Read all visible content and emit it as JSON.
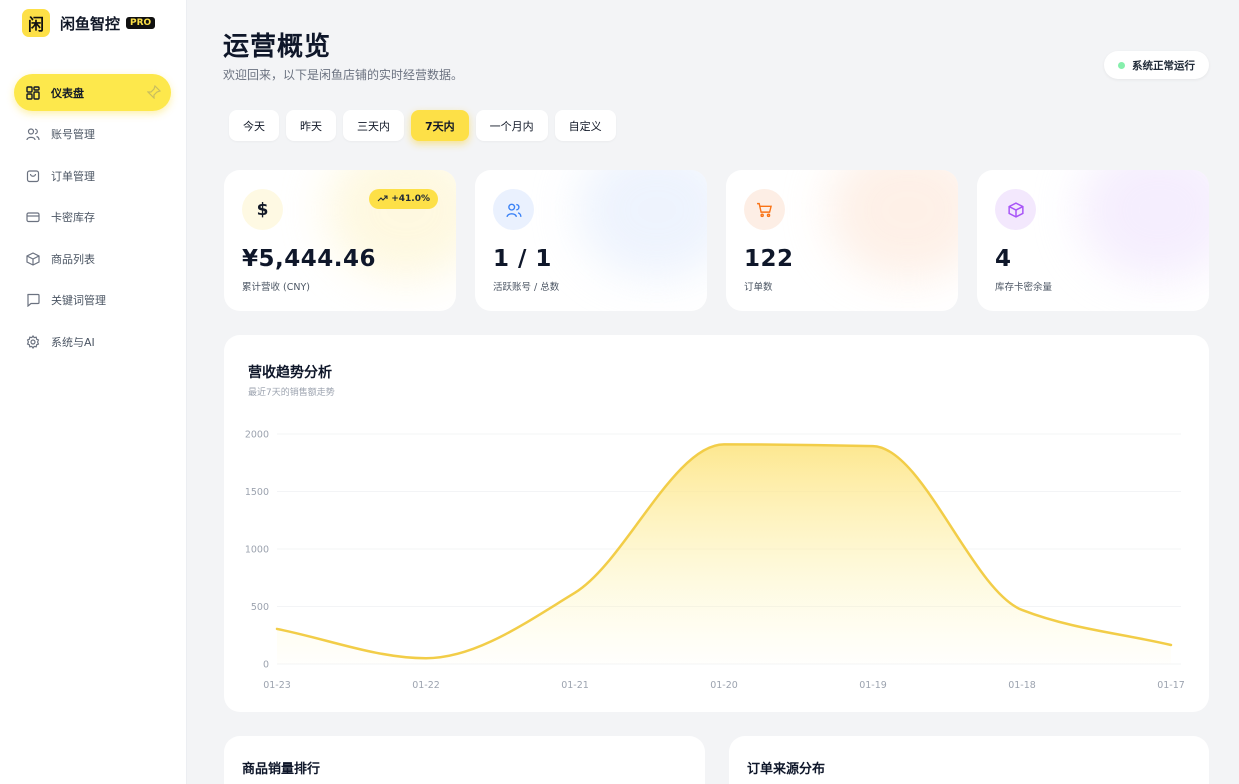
{
  "brand": {
    "logo_char": "闲",
    "name": "闲鱼智控",
    "badge": "PRO"
  },
  "sidebar": {
    "items": [
      {
        "label": "仪表盘",
        "icon": "dashboard-icon",
        "active": true
      },
      {
        "label": "账号管理",
        "icon": "users-icon"
      },
      {
        "label": "订单管理",
        "icon": "shopping-bag-icon"
      },
      {
        "label": "卡密库存",
        "icon": "card-icon"
      },
      {
        "label": "商品列表",
        "icon": "box-icon"
      },
      {
        "label": "关键词管理",
        "icon": "chat-icon"
      },
      {
        "label": "系统与AI",
        "icon": "gear-icon"
      }
    ]
  },
  "header": {
    "title": "运营概览",
    "subtitle": "欢迎回来，以下是闲鱼店铺的实时经营数据。",
    "status": "系统正常运行",
    "status_color": "#86efac"
  },
  "range_tabs": [
    {
      "label": "今天"
    },
    {
      "label": "昨天"
    },
    {
      "label": "三天内"
    },
    {
      "label": "7天内",
      "active": true
    },
    {
      "label": "一个月内"
    },
    {
      "label": "自定义"
    }
  ],
  "stats": [
    {
      "icon_char": "$",
      "icon": "dollar-icon",
      "value": "¥5,444.46",
      "label": "累计营收 (CNY)",
      "trend": "+41.0%",
      "color": "#fde047",
      "bg": "#fef9e3"
    },
    {
      "icon": "users-icon",
      "value": "1 / 1",
      "label": "活跃账号 / 总数",
      "color": "#3b82f6",
      "bg": "#eaf1fe"
    },
    {
      "icon": "cart-icon",
      "value": "122",
      "label": "订单数",
      "color": "#f97316",
      "bg": "#fdeee5"
    },
    {
      "icon": "box-icon",
      "value": "4",
      "label": "库存卡密余量",
      "color": "#a855f7",
      "bg": "#f3e8fd"
    }
  ],
  "chart": {
    "title": "营收趋势分析",
    "subtitle": "最近7天的销售额走势"
  },
  "chart_data": {
    "type": "area",
    "categories": [
      "01-23",
      "01-22",
      "01-21",
      "01-20",
      "01-19",
      "01-18",
      "01-17"
    ],
    "values": [
      305,
      50,
      620,
      1910,
      1895,
      470,
      165
    ],
    "ylim": [
      0,
      2000
    ],
    "yticks": [
      0,
      500,
      1000,
      1500,
      2000
    ],
    "grid": true,
    "line_color": "#f2cd48",
    "fill_color": "#fde68a"
  },
  "bottom": {
    "left_title": "商品销量排行",
    "right_title": "订单来源分布"
  }
}
